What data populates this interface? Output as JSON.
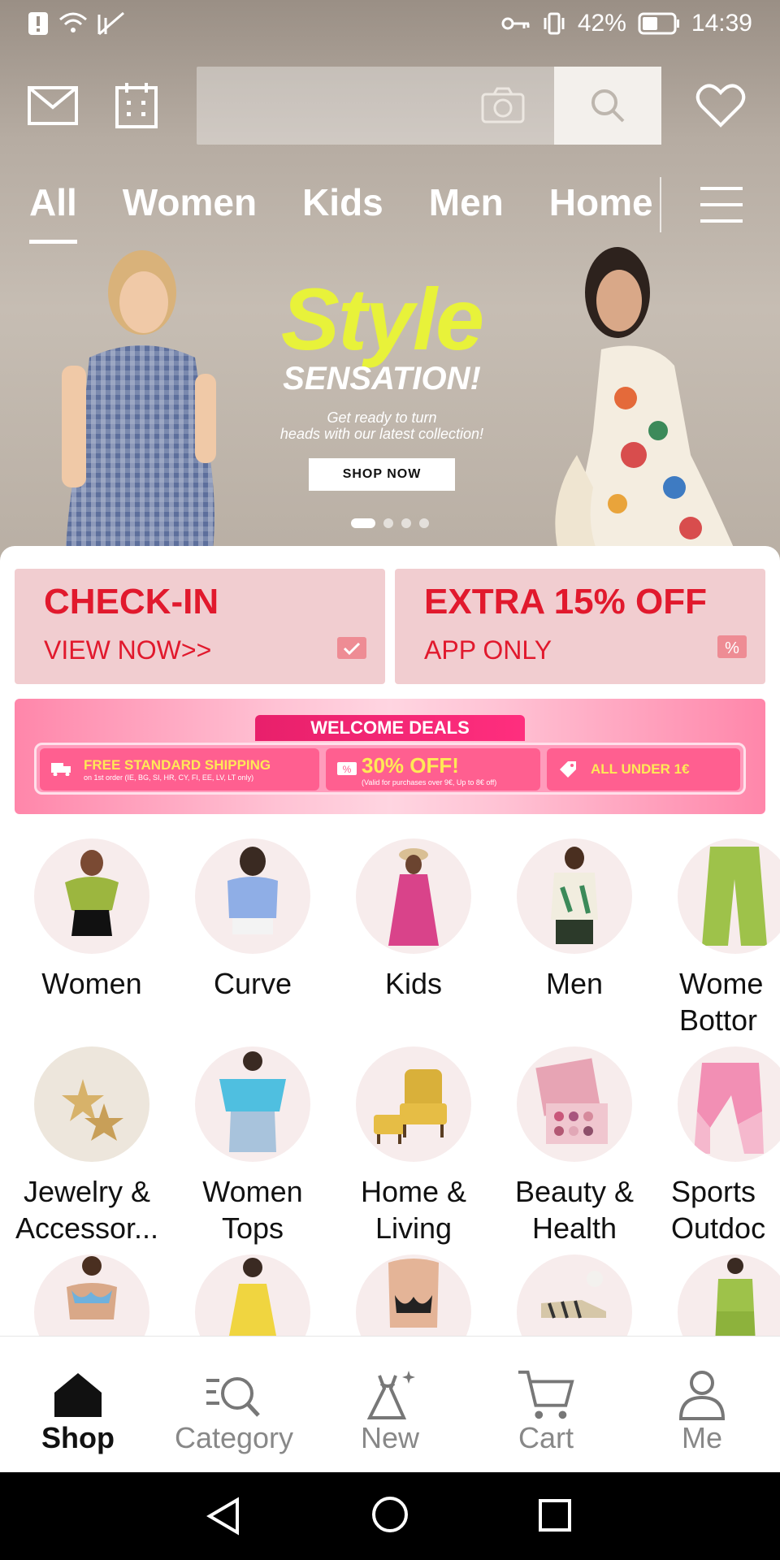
{
  "status_bar": {
    "battery": "42%",
    "time": "14:39"
  },
  "search": {
    "placeholder": ""
  },
  "tabs": [
    {
      "label": "All",
      "active": true
    },
    {
      "label": "Women",
      "active": false
    },
    {
      "label": "Kids",
      "active": false
    },
    {
      "label": "Men",
      "active": false
    },
    {
      "label": "Home",
      "active": false
    }
  ],
  "banner": {
    "title": "Style",
    "subtitle": "SENSATION!",
    "tagline_1": "Get ready to turn",
    "tagline_2": "heads with our latest collection!",
    "cta": "SHOP NOW",
    "slide_count": 4,
    "active_slide": 1
  },
  "promo_cards": [
    {
      "title": "CHECK-IN",
      "subtitle": "VIEW NOW>>",
      "icon": "calendar-check-icon"
    },
    {
      "title": "EXTRA 15% OFF",
      "subtitle": "APP ONLY",
      "icon": "percent-tag-icon"
    }
  ],
  "welcome_deals": {
    "title": "WELCOME DEALS",
    "deals": [
      {
        "title": "FREE STANDARD SHIPPING",
        "note": "on 1st order (IE, BG, SI, HR, CY, FI, EE, LV, LT only)",
        "icon": "truck-icon"
      },
      {
        "title": "30% OFF!",
        "note": "(Valid for purchases over 9€, Up to 8€ off)",
        "icon": "coupon-icon"
      },
      {
        "title": "ALL UNDER 1€",
        "note": "",
        "icon": "price-tag-icon"
      }
    ]
  },
  "categories": [
    {
      "label": "Women",
      "label2": ""
    },
    {
      "label": "Curve",
      "label2": ""
    },
    {
      "label": "Kids",
      "label2": ""
    },
    {
      "label": "Men",
      "label2": ""
    },
    {
      "label": "Wome",
      "label2": "Bottor"
    },
    {
      "label": "Jewelry &",
      "label2": "Accessor..."
    },
    {
      "label": "Women",
      "label2": "Tops"
    },
    {
      "label": "Home &",
      "label2": "Living"
    },
    {
      "label": "Beauty &",
      "label2": "Health"
    },
    {
      "label": "Sports",
      "label2": "Outdoc"
    }
  ],
  "bottom_nav": [
    {
      "label": "Shop",
      "active": true,
      "icon": "home-icon"
    },
    {
      "label": "Category",
      "active": false,
      "icon": "category-search-icon"
    },
    {
      "label": "New",
      "active": false,
      "icon": "dress-sparkle-icon"
    },
    {
      "label": "Cart",
      "active": false,
      "icon": "cart-icon"
    },
    {
      "label": "Me",
      "active": false,
      "icon": "person-icon"
    }
  ],
  "colors": {
    "promo_red": "#e1192d",
    "banner_yellow": "#e8f23a",
    "deal_pink": "#ff5f90"
  }
}
